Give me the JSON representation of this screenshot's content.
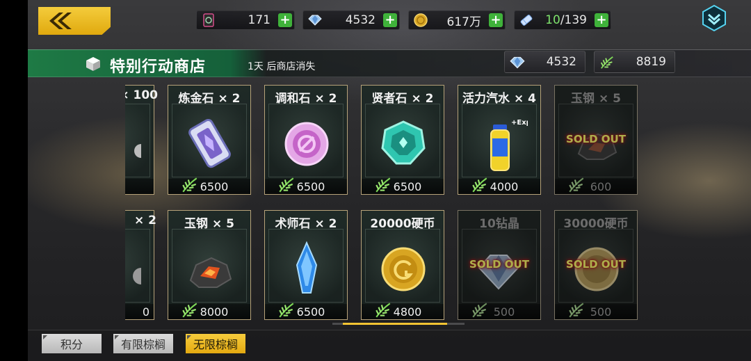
{
  "top_bar": {
    "stamina": "171",
    "diamonds": "4532",
    "coins": "617万",
    "tickets_current": "10",
    "tickets_sep_max": "/139"
  },
  "shop": {
    "title": "特别行动商店",
    "timer": "1天 后商店消失",
    "diamonds": "4532",
    "palm_points": "8819"
  },
  "sold_out_label": "SOLD OUT",
  "items_row1": [
    {
      "title": "× 100",
      "price": ""
    },
    {
      "title": "炼金石 × 2",
      "price": "6500"
    },
    {
      "title": "调和石 × 2",
      "price": "6500"
    },
    {
      "title": "贤者石 × 2",
      "price": "6500"
    },
    {
      "title": "活力汽水 × 4",
      "price": "4000"
    },
    {
      "title": "玉钢 × 5",
      "price": "600"
    }
  ],
  "items_row2": [
    {
      "title": "× 2",
      "price": "0"
    },
    {
      "title": "玉钢 × 5",
      "price": "8000"
    },
    {
      "title": "术师石 × 2",
      "price": "6500"
    },
    {
      "title": "20000硬币",
      "price": "4800"
    },
    {
      "title": "10钻晶",
      "price": "500"
    },
    {
      "title": "30000硬币",
      "price": "500"
    }
  ],
  "tabs": [
    {
      "label": "积分"
    },
    {
      "label": "有限棕榈"
    },
    {
      "label": "无限棕榈"
    }
  ],
  "colors": {
    "accent": "#f4c433",
    "header_green": "#1e7a45",
    "plus_green": "#3fb23a"
  }
}
